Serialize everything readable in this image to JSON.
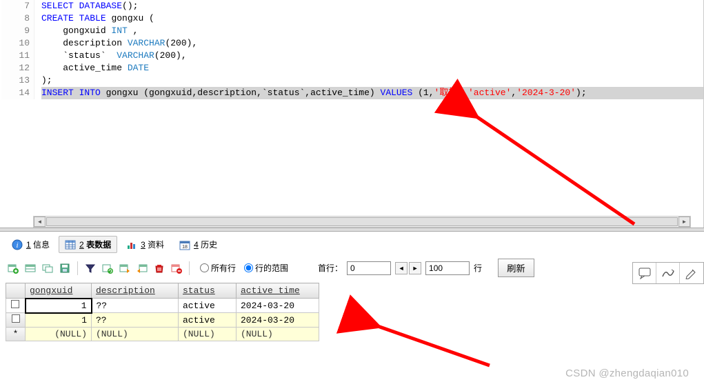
{
  "editor": {
    "lines": [
      {
        "n": 7,
        "html": "<span class='kw'>SELECT</span> <span class='kw'>DATABASE</span>();"
      },
      {
        "n": 8,
        "html": "<span class='kw'>CREATE</span> <span class='kw'>TABLE</span> gongxu ("
      },
      {
        "n": 9,
        "html": "    gongxuid <span class='type'>INT</span> ,"
      },
      {
        "n": 10,
        "html": "    description <span class='type'>VARCHAR</span>(200),"
      },
      {
        "n": 11,
        "html": "    `status`  <span class='type'>VARCHAR</span>(200),"
      },
      {
        "n": 12,
        "html": "    active_time <span class='type'>DATE</span>"
      },
      {
        "n": 13,
        "html": ");"
      },
      {
        "n": 14,
        "highlighted": true,
        "html": "<span class='kw'>INSERT</span> <span class='kw'>INTO</span> gongxu (gongxuid,description,`status`,active_time) <span class='kw'>VALUES</span> (1,<span class='str'>'取板'</span>,<span class='str'>'active'</span>,<span class='str'>'2024-3-20'</span>);"
      }
    ]
  },
  "tabs": {
    "info": {
      "num": "1",
      "label": "信息"
    },
    "data": {
      "num": "2",
      "label": "表数据"
    },
    "assets": {
      "num": "3",
      "label": "资料"
    },
    "history": {
      "num": "4",
      "label": "历史"
    }
  },
  "toolbar": {
    "radio_all": "所有行",
    "radio_range": "行的范围",
    "first_row_label": "首行：",
    "first_row_value": "0",
    "row_count_value": "100",
    "row_suffix": "行",
    "refresh_label": "刷新"
  },
  "grid": {
    "columns": [
      "gongxuid",
      "description",
      "status",
      "active_time"
    ],
    "rows": [
      {
        "selector": "checkbox",
        "selected": true,
        "cells": [
          "1",
          "??",
          "active",
          "2024-03-20"
        ]
      },
      {
        "selector": "checkbox",
        "selected": false,
        "cells": [
          "1",
          "??",
          "active",
          "2024-03-20"
        ]
      },
      {
        "selector": "star",
        "selected": false,
        "cells": [
          "(NULL)",
          "(NULL)",
          "(NULL)",
          "(NULL)"
        ]
      }
    ]
  },
  "watermark": "CSDN @zhengdaqian010"
}
